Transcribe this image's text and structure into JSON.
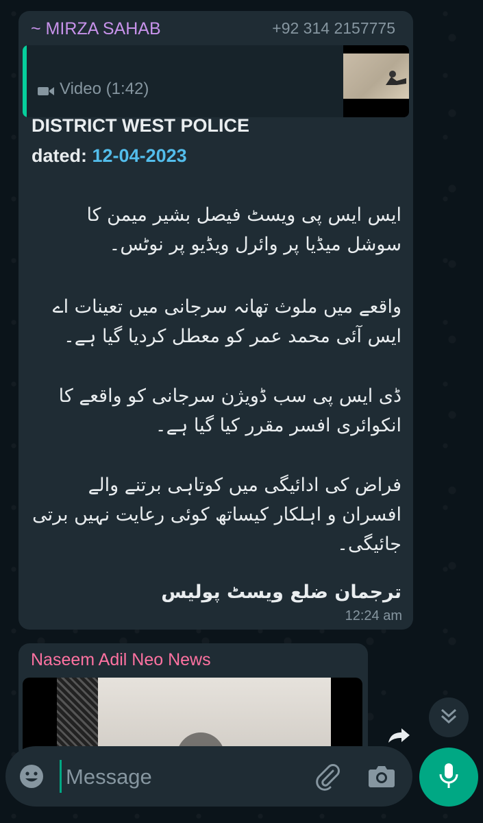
{
  "message1": {
    "sender": "~ MIRZA SAHAB",
    "phone": "+92 314 2157775",
    "quoted": {
      "label": "Video (1:42)",
      "icon": "video-camera-icon"
    },
    "title": "DISTRICT WEST POLICE",
    "dated_label": "dated:",
    "dated_value": "12-04-2023",
    "para1": "ایس ایس پی ویسٹ فیصل بشیر میمن کا سوشل میڈیا پر وائرل ویڈیو پر نوٹس۔",
    "para2": "واقعے میں ملوث تھانہ سرجانی میں تعینات اے ایس آئی محمد عمر کو معطل کردیا گیا ہے۔",
    "para3": "ڈی ایس پی سب ڈویژن سرجانی کو واقعے کا انکوائری افسر مقرر کیا گیا ہے۔",
    "para4": "فراض کی ادائیگی میں کوتاہی برتنے والے افسران و اہلکار کیساتھ کوئی رعایت نہیں برتی جائیگی۔",
    "signature": "ترجمان ضلع ویسٹ پولیس",
    "time": "12:24 am"
  },
  "message2": {
    "sender": "Naseem Adil Neo News"
  },
  "composer": {
    "placeholder": "Message"
  },
  "colors": {
    "background": "#0b141a",
    "bubble": "#1f2c34",
    "accent": "#00a884",
    "sender1": "#c792ea",
    "sender2": "#ff72a1",
    "date_link": "#53bdeb"
  }
}
